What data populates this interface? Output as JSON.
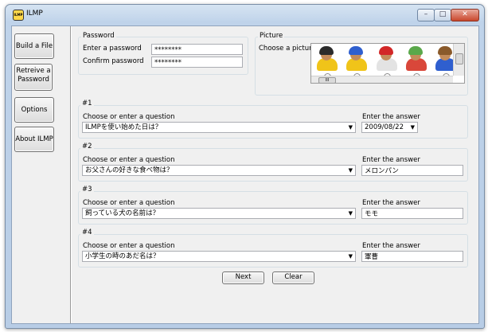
{
  "window": {
    "title": "ILMP",
    "app_icon": "ILMP"
  },
  "titlebar_icons": {
    "minimize": "minimize-icon",
    "maximize": "maximize-icon",
    "close": "close-icon"
  },
  "sidebar": {
    "build": "Build a File",
    "retrieve_line1": "Retreive a",
    "retrieve_line2": "Password",
    "options": "Options",
    "about": "About ILMP"
  },
  "password": {
    "group": "Password",
    "enter_label": "Enter a password",
    "enter_value": "********",
    "confirm_label": "Confirm password",
    "confirm_value": "********"
  },
  "picture": {
    "group": "Picture",
    "label": "Choose a picture",
    "scroll_glyph": "III",
    "avatars": [
      {
        "name": "avatar-black-helmet",
        "helmet": "#2b2b2b",
        "body": "#f0c419",
        "selected": true
      },
      {
        "name": "avatar-blue-helmet",
        "helmet": "#2f5fcf",
        "body": "#f0c419",
        "selected": false
      },
      {
        "name": "avatar-red-helmet",
        "helmet": "#d22727",
        "body": "#e3e3e3",
        "selected": false
      },
      {
        "name": "avatar-green-helmet",
        "helmet": "#5aa84a",
        "body": "#d9473a",
        "selected": false
      },
      {
        "name": "avatar-brown-helmet",
        "helmet": "#8a5a2b",
        "body": "#2f5fcf",
        "selected": false
      }
    ]
  },
  "questions": [
    {
      "number": "#1",
      "q_label": "Choose or enter a question",
      "question": "ILMPを使い始めた日は？",
      "a_label": "Enter the answer",
      "answer": "2009/08/22",
      "answer_dropdown": true
    },
    {
      "number": "#2",
      "q_label": "Choose or enter a question",
      "question": "お父さんの好きな食べ物は？",
      "a_label": "Enter the answer",
      "answer": "メロンパン",
      "answer_dropdown": false
    },
    {
      "number": "#3",
      "q_label": "Choose or enter a question",
      "question": "飼っている犬の名前は？",
      "a_label": "Enter the answer",
      "answer": "モモ",
      "answer_dropdown": false
    },
    {
      "number": "#4",
      "q_label": "Choose or enter a question",
      "question": "小学生の時のあだ名は？",
      "a_label": "Enter the answer",
      "answer": "軍曹",
      "answer_dropdown": false
    }
  ],
  "buttons": {
    "next": "Next",
    "clear": "Clear"
  },
  "dropdown_arrow": "▼"
}
